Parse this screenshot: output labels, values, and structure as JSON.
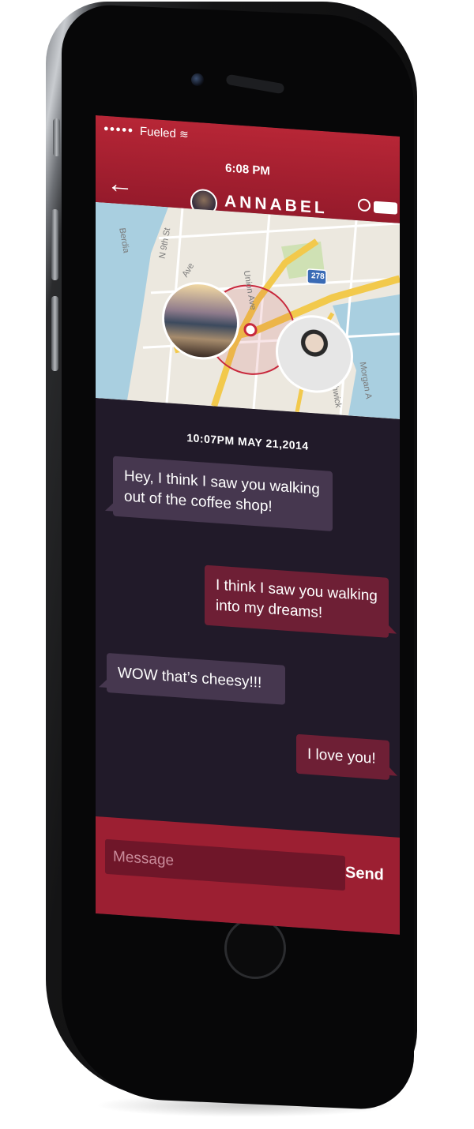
{
  "status_bar": {
    "signal": "●●●●●",
    "carrier": "Fueled",
    "wifi": "≋",
    "time": "6:08 PM"
  },
  "header": {
    "back_icon": "arrow-left-icon",
    "contact_name": "ANNABEL",
    "profile_icon": "user-outline-icon"
  },
  "map": {
    "labels": {
      "street_1": "Union Ave",
      "street_2": "Bushwick",
      "street_3": "Morgan A",
      "street_4": "N 9th St",
      "street_5": "Berdia",
      "street_6": "Ave",
      "highway_shield": "278"
    },
    "colors": {
      "water": "#a9cfe0",
      "road": "#f2c94c",
      "land": "#ece8df",
      "park": "#cfe1b4",
      "radius": "#c8283c"
    }
  },
  "chat": {
    "timestamp": "10:07PM MAY 21,2014",
    "messages": [
      {
        "direction": "in",
        "text": "Hey, I think I saw you walking out of the coffee shop!"
      },
      {
        "direction": "out",
        "text": "I think I saw you walking into my dreams!"
      },
      {
        "direction": "in",
        "text": "WOW that’s cheesy!!!"
      },
      {
        "direction": "out",
        "text": "I love you!"
      }
    ]
  },
  "composer": {
    "placeholder": "Message",
    "send_label": "Send"
  },
  "colors": {
    "accent": "#a8212f",
    "background": "#211a29",
    "incoming_bubble": "#46374f",
    "outgoing_bubble": "#6e1f35"
  }
}
